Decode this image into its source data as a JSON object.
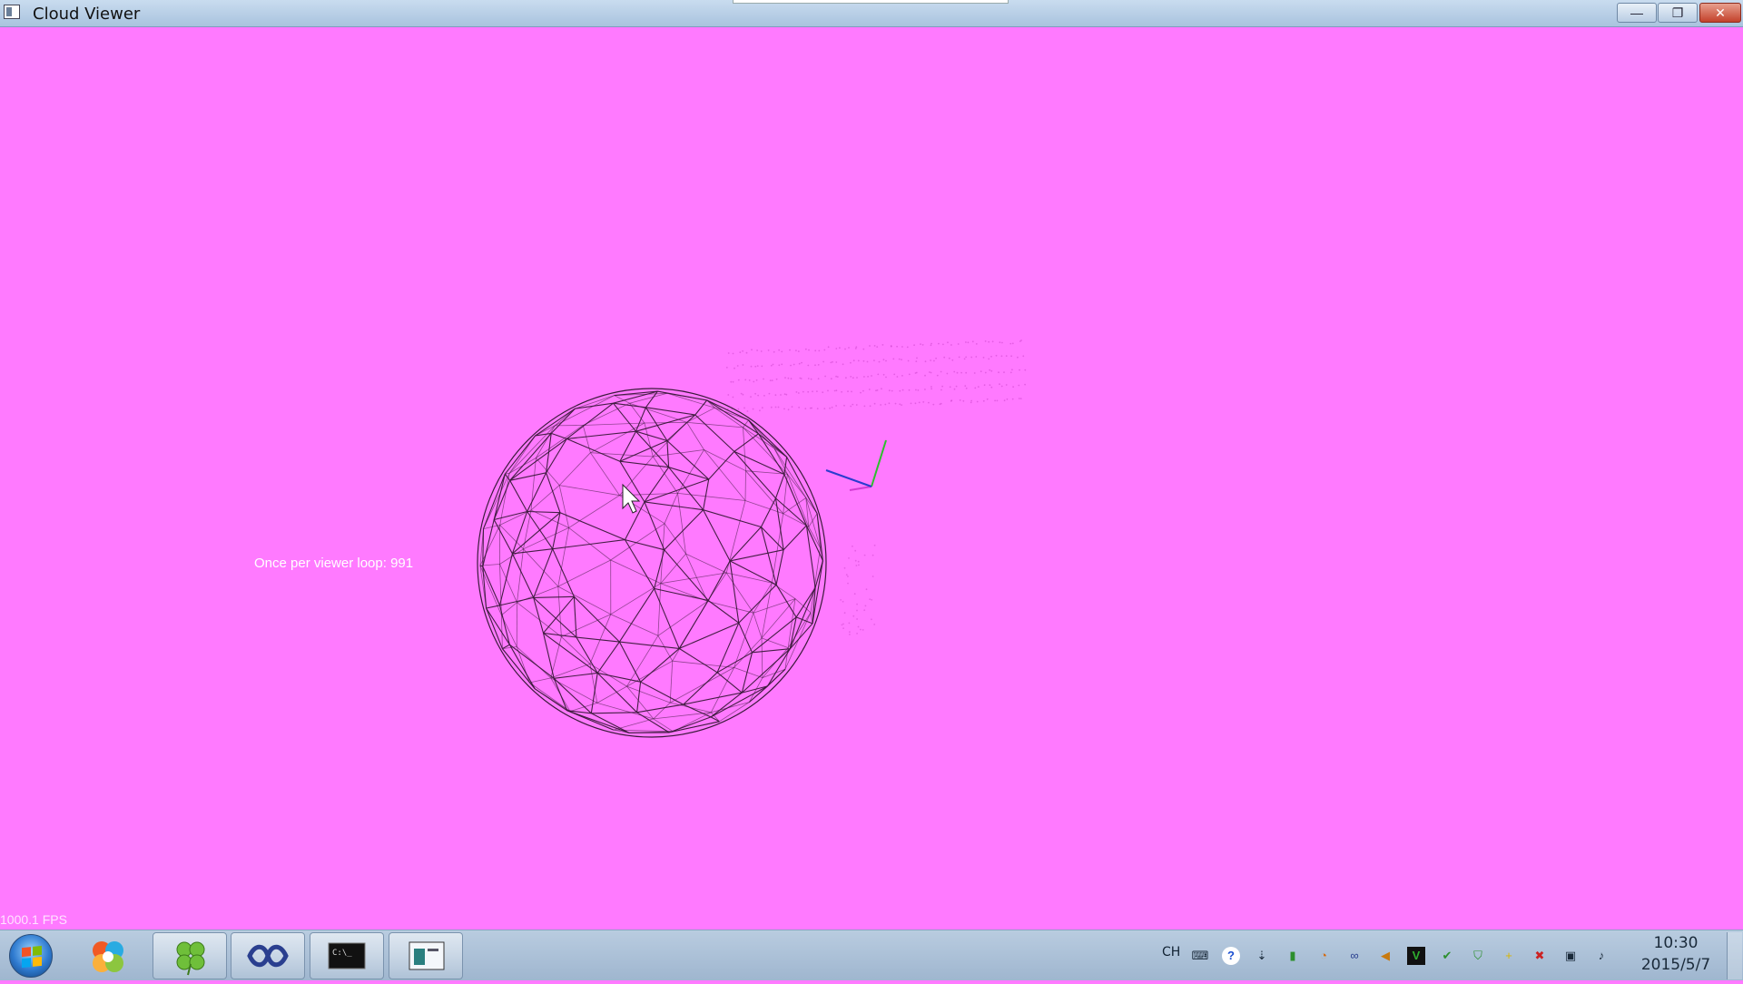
{
  "window": {
    "title": "Cloud Viewer",
    "buttons": {
      "minimize": "—",
      "restore": "❐",
      "close": "✕"
    }
  },
  "viewport": {
    "background_color": "#ff7aff",
    "overlay_text": "Once per viewer loop: 991",
    "fps_text": "1000.1 FPS",
    "mesh_color": "#3a1a3a",
    "axis_colors": {
      "x": "#d23cd2",
      "y": "#2dbf2d",
      "z": "#2b3ccf"
    }
  },
  "taskbar": {
    "start": "start-button",
    "pinned": [
      {
        "name": "picasa-icon"
      },
      {
        "name": "clover-icon"
      },
      {
        "name": "visual-studio-icon"
      },
      {
        "name": "command-prompt-icon"
      },
      {
        "name": "cloud-viewer-window-icon"
      }
    ],
    "tray": {
      "language": "CH",
      "icons": [
        "keyboard-icon",
        "help-icon",
        "ime-options-icon",
        "usb-drive-icon",
        "search-tool-icon",
        "infinity-icon",
        "volume-icon",
        "vc-icon",
        "shield-check-icon",
        "security-shield-icon",
        "plus-icon",
        "network-error-icon",
        "network-icon",
        "speaker-icon"
      ]
    },
    "clock": {
      "time": "10:30",
      "date": "2015/5/7"
    }
  }
}
